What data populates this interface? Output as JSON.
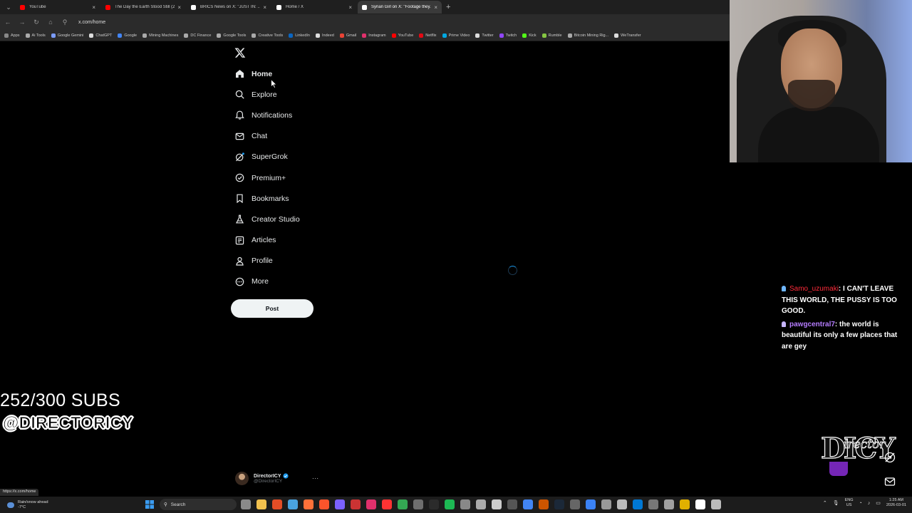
{
  "browser": {
    "tabs": [
      {
        "title": "YouTube",
        "color": "#ff0000",
        "active": false
      },
      {
        "title": "The Day the Earth Stood Still (2...",
        "color": "#ff0000",
        "active": false
      },
      {
        "title": "BRICS News on X: \"JUST IN: ...",
        "color": "#ffffff",
        "active": false
      },
      {
        "title": "Home / X",
        "color": "#ffffff",
        "active": false
      },
      {
        "title": "Syrian Girl on X: \"Footage they...",
        "color": "#ffffff",
        "active": true
      }
    ],
    "new_tab": "+",
    "url": "x.com/home",
    "bookmarks": [
      {
        "label": "Apps",
        "color": "#888888"
      },
      {
        "label": "Ai Tools",
        "color": "#aaaaaa"
      },
      {
        "label": "Google Gemini",
        "color": "#7b9cff"
      },
      {
        "label": "ChatGPT",
        "color": "#dddddd"
      },
      {
        "label": "Google",
        "color": "#4285f4"
      },
      {
        "label": "Mining Machines",
        "color": "#aaaaaa"
      },
      {
        "label": "DC Finance",
        "color": "#aaaaaa"
      },
      {
        "label": "Google Tools",
        "color": "#aaaaaa"
      },
      {
        "label": "Creative Tools",
        "color": "#aaaaaa"
      },
      {
        "label": "LinkedIn",
        "color": "#0a66c2"
      },
      {
        "label": "Indeed",
        "color": "#dddddd"
      },
      {
        "label": "Gmail",
        "color": "#ea4335"
      },
      {
        "label": "Instagram",
        "color": "#e1306c"
      },
      {
        "label": "YouTube",
        "color": "#ff0000"
      },
      {
        "label": "Netflix",
        "color": "#e50914"
      },
      {
        "label": "Prime Video",
        "color": "#00a8e1"
      },
      {
        "label": "Twitter",
        "color": "#dddddd"
      },
      {
        "label": "Twitch",
        "color": "#9146ff"
      },
      {
        "label": "Kick",
        "color": "#53fc18"
      },
      {
        "label": "Rumble",
        "color": "#85c742"
      },
      {
        "label": "Bitcoin Mining Rig...",
        "color": "#aaaaaa"
      },
      {
        "label": "WeTransfer",
        "color": "#dddddd"
      }
    ],
    "status_url": "https://x.com/home"
  },
  "sidebar": {
    "logo": "x-logo",
    "items": [
      {
        "label": "Home",
        "icon": "home-icon"
      },
      {
        "label": "Explore",
        "icon": "search-icon"
      },
      {
        "label": "Notifications",
        "icon": "bell-icon"
      },
      {
        "label": "Chat",
        "icon": "mail-icon"
      },
      {
        "label": "SuperGrok",
        "icon": "grok-icon"
      },
      {
        "label": "Premium+",
        "icon": "premium-icon"
      },
      {
        "label": "Bookmarks",
        "icon": "bookmark-icon"
      },
      {
        "label": "Creator Studio",
        "icon": "flask-icon"
      },
      {
        "label": "Articles",
        "icon": "article-icon"
      },
      {
        "label": "Profile",
        "icon": "person-icon"
      },
      {
        "label": "More",
        "icon": "more-circle-icon"
      }
    ],
    "post_label": "Post",
    "account": {
      "name": "DirectorICY",
      "handle": "@DirectorICY",
      "more": "···"
    }
  },
  "overlay": {
    "subs_text": "252/300 SUBS",
    "channel_handle": "@DIRECTORICY",
    "chat": [
      {
        "user": "Samo_uzumaki",
        "text": ": I CAN'T LEAVE THIS WORLD, THE PUSSY IS TOO GOOD.",
        "badge_color": "#6fb7ff"
      },
      {
        "user": "pawgcentral7",
        "text": ": the world is beautiful its only a few places that are gey",
        "badge_color": "#c8b6ff"
      }
    ],
    "logo_big": "DICY",
    "logo_small": "irector"
  },
  "taskbar": {
    "weather_line1": "Rain/snow ahead",
    "weather_line2": "-7°C",
    "search_label": "Search",
    "lang_line1": "ENG",
    "lang_line2": "US",
    "time": "1:25 AM",
    "date": "2026-03-01",
    "apps": [
      "#8a8a8a",
      "#f2c14e",
      "#e44d26",
      "#4aa3df",
      "#ff7139",
      "#fb542b",
      "#7b61ff",
      "#cc3333",
      "#e1306c",
      "#ff3333",
      "#34a853",
      "#6e6e6e",
      "#2b2b2b",
      "#1db954",
      "#888888",
      "#aaaaaa",
      "#cccccc",
      "#555555",
      "#4285f4",
      "#cc5500",
      "#1b2838",
      "#666666",
      "#3b82f6",
      "#999999",
      "#bbbbbb",
      "#0078d4",
      "#777777",
      "#a0a0a0",
      "#e0b000",
      "#ffffff",
      "#bbbbbb"
    ]
  }
}
